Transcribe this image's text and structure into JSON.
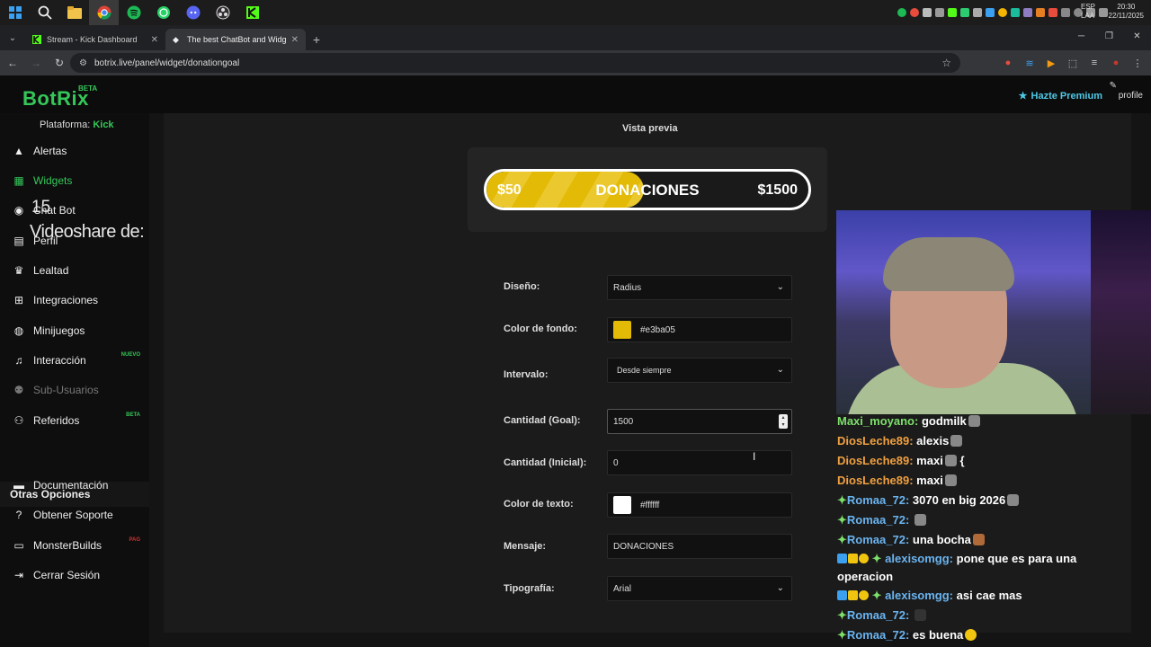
{
  "taskbar": {
    "lang": "ESP",
    "lang2": "LAA",
    "time": "20:30",
    "date": "22/11/2025"
  },
  "browser": {
    "tabs": [
      {
        "label": "Stream - Kick Dashboard",
        "active": false
      },
      {
        "label": "The best ChatBot and Widgets",
        "active": true
      }
    ],
    "url": "botrix.live/panel/widget/donationgoal"
  },
  "app": {
    "logo": "BotRix",
    "beta": "BETA",
    "premium": "Hazte Premium",
    "profile": "profile",
    "platform_label": "Plataforma:",
    "platform_value": "Kick"
  },
  "sidebar": {
    "items": [
      {
        "label": "Alertas",
        "icon": "warning-icon",
        "state": "normal"
      },
      {
        "label": "Widgets",
        "icon": "grid-icon",
        "state": "active"
      },
      {
        "label": "Chat Bot",
        "icon": "robot-icon",
        "state": "normal"
      },
      {
        "label": "Perfil",
        "icon": "id-card-icon",
        "state": "normal"
      },
      {
        "label": "Lealtad",
        "icon": "trophy-icon",
        "state": "normal"
      },
      {
        "label": "Integraciones",
        "icon": "plug-icon",
        "state": "normal"
      },
      {
        "label": "Minijuegos",
        "icon": "gamepad-icon",
        "state": "normal"
      },
      {
        "label": "Interacción",
        "icon": "music-icon",
        "state": "normal",
        "badge": "NUEVO"
      },
      {
        "label": "Sub-Usuarios",
        "icon": "users-icon",
        "state": "dim"
      },
      {
        "label": "Referidos",
        "icon": "user-plus-icon",
        "state": "normal",
        "badge": "BETA"
      }
    ],
    "other_title": "Otras Opciones",
    "other_items": [
      {
        "label": "Documentación",
        "icon": "book-icon"
      },
      {
        "label": "Obtener Soporte",
        "icon": "help-icon"
      },
      {
        "label": "MonsterBuilds",
        "icon": "monitor-icon",
        "badge": "PAG"
      },
      {
        "label": "Cerrar Sesión",
        "icon": "logout-icon"
      }
    ]
  },
  "overlay": {
    "number": "15",
    "text": "Videoshare de:"
  },
  "preview": {
    "title": "Vista previa",
    "goal_current": "$50",
    "goal_message": "DONACIONES",
    "goal_target": "$1500",
    "fill_fraction": 0.49,
    "bar_color": "#e3ba05"
  },
  "form": {
    "diseno_label": "Diseño:",
    "diseno_value": "Radius",
    "color_fondo_label": "Color de fondo:",
    "color_fondo_value": "#e3ba05",
    "intervalo_label": "Intervalo:",
    "intervalo_value": "Desde siempre",
    "cantidad_goal_label": "Cantidad (Goal):",
    "cantidad_goal_value": "1500",
    "cantidad_inicial_label": "Cantidad (Inicial):",
    "cantidad_inicial_value": "0",
    "color_texto_label": "Color de texto:",
    "color_texto_value": "#ffffff",
    "mensaje_label": "Mensaje:",
    "mensaje_value": "DONACIONES",
    "tipografia_label": "Tipografía:",
    "tipografia_value": "Arial"
  },
  "chat": [
    {
      "user": "Maxi_moyano:",
      "msg": "godmilk",
      "color": "green"
    },
    {
      "user": "DiosLeche89:",
      "msg": "alexis",
      "color": "orange"
    },
    {
      "user": "DiosLeche89:",
      "msg": "maxi",
      "suffix": "{",
      "color": "orange"
    },
    {
      "user": "DiosLeche89:",
      "msg": "maxi",
      "color": "orange"
    },
    {
      "user": "Romaa_72:",
      "msg": "3070 en big 2026",
      "color": "blue",
      "sparkle": true
    },
    {
      "user": "Romaa_72:",
      "msg": "",
      "color": "blue",
      "sparkle": true
    },
    {
      "user": "Romaa_72:",
      "msg": "una bocha",
      "color": "blue",
      "sparkle": true
    },
    {
      "user": "alexisomgg:",
      "msg": "pone que es para una operacion",
      "color": "blue",
      "badges": true
    },
    {
      "user": "alexisomgg:",
      "msg": "asi cae mas",
      "color": "blue",
      "badges": true
    },
    {
      "user": "Romaa_72:",
      "msg": "",
      "color": "blue",
      "sparkle": true
    },
    {
      "user": "Romaa_72:",
      "msg": "es buena",
      "color": "blue",
      "sparkle": true
    }
  ]
}
